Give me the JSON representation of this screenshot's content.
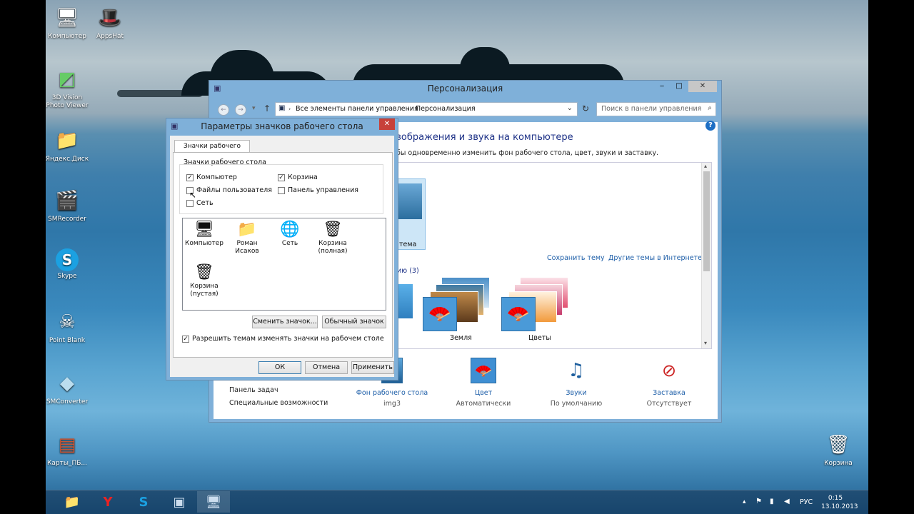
{
  "desktop_icons": [
    {
      "label": "Компьютер",
      "glyph": "🖥"
    },
    {
      "label": "AppsHat",
      "glyph": "🎩"
    },
    {
      "label": "3D Vision Photo Viewer",
      "glyph": "◩"
    },
    {
      "label": "Яндекс.Диск",
      "glyph": "📁"
    },
    {
      "label": "SMRecorder",
      "glyph": "🎬"
    },
    {
      "label": "Skype",
      "glyph": "S"
    },
    {
      "label": "Point Blank",
      "glyph": "☠"
    },
    {
      "label": "SMConverter",
      "glyph": "◆"
    },
    {
      "label": "Карты_ПБ...",
      "glyph": "▤"
    },
    {
      "label": "Корзина",
      "glyph": "🗑"
    }
  ],
  "personalization": {
    "title": "Персонализация",
    "address": {
      "part1": "Все элементы панели управления",
      "part2": "Персонализация"
    },
    "search_placeholder": "Поиск в панели управления",
    "heading": "зображения и звука на компьютере",
    "subtext": "бы одновременно изменить фон рабочего стола, цвет, звуки и заставку.",
    "theme_selected_label": "тема",
    "save_theme": "Сохранить тему",
    "more_themes": "Другие темы в Интернете",
    "group_label": "ию (3)",
    "themes": [
      "Земля",
      "Цветы"
    ],
    "side_links": [
      "Панель задач",
      "Специальные возможности"
    ],
    "bottom": [
      {
        "title": "Фон рабочего стола",
        "value": "img3",
        "icon": "desktop-background-icon"
      },
      {
        "title": "Цвет",
        "value": "Автоматически",
        "icon": "color-icon"
      },
      {
        "title": "Звуки",
        "value": "По умолчанию",
        "icon": "sounds-icon"
      },
      {
        "title": "Заставка",
        "value": "Отсутствует",
        "icon": "screensaver-icon"
      }
    ]
  },
  "dialog": {
    "title": "Параметры значков рабочего стола",
    "tab": "Значки рабочего стола",
    "group": "Значки рабочего стола",
    "checkboxes": [
      {
        "label": "Компьютер",
        "checked": true
      },
      {
        "label": "Корзина",
        "checked": true
      },
      {
        "label": "Файлы пользователя",
        "checked": false
      },
      {
        "label": "Панель управления",
        "checked": false
      },
      {
        "label": "Сеть",
        "checked": false
      }
    ],
    "icons": [
      {
        "label": "Компьютер",
        "glyph": "🖥"
      },
      {
        "label": "Роман Исаков",
        "glyph": "📁"
      },
      {
        "label": "Сеть",
        "glyph": "🌐"
      },
      {
        "label": "Корзина (полная)",
        "glyph": "🗑"
      },
      {
        "label": "Корзина (пустая)",
        "glyph": "🗑"
      }
    ],
    "change_icon": "Сменить значок...",
    "default_icon": "Обычный значок",
    "allow_themes": "Разрешить темам изменять значки на рабочем столе",
    "allow_themes_checked": true,
    "ok": "ОК",
    "cancel": "Отмена",
    "apply": "Применить"
  },
  "taskbar": {
    "lang": "РУС",
    "time": "0:15",
    "date": "13.10.2013"
  }
}
